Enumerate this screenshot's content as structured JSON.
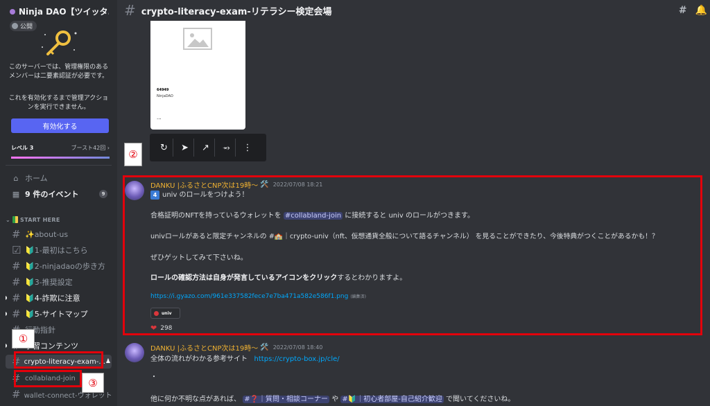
{
  "server": {
    "name": "Ninja DAO【ツイッタ...",
    "public_label": "公開"
  },
  "auth": {
    "text1": "このサーバーでは、管理権限のあるメンバーは二要素認証が必要です。",
    "text2": "これを有効化するまで管理アクションを実行できません。",
    "enable_label": "有効化する"
  },
  "level": {
    "label": "レベル 3",
    "boost": "ブースト42回 ›"
  },
  "nav": {
    "home": "ホーム",
    "events": "9 件のイベント",
    "events_count": "9"
  },
  "category": "START HERE",
  "channels": [
    {
      "label": "✨about-us"
    },
    {
      "label": "🔰1-最初はこちら"
    },
    {
      "label": "🔰2-ninjadaoの歩き方"
    },
    {
      "label": "🔰3-推奨設定"
    },
    {
      "label": "🔰4-詐欺に注意"
    },
    {
      "label": "🔰5-サイトマップ"
    },
    {
      "label": "行動指針"
    },
    {
      "label": "学習コンテンツ"
    },
    {
      "label": "crypto-literacy-exam-..."
    },
    {
      "label": "collabland-join"
    },
    {
      "label": "wallet-connect-ウォレット..."
    }
  ],
  "annotations": {
    "n1": "①",
    "n2": "②",
    "n3": "③"
  },
  "header": {
    "channel": "crypto-literacy-exam-リテラシー検定会場"
  },
  "card": {
    "line1": "64949",
    "line2": "NinjaDAO",
    "line3": "..."
  },
  "message1": {
    "user": "DANKU |ふるさとCNP次は19時〜",
    "tool": "🛠️",
    "time": "2022/07/08 18:21",
    "num": "4",
    "line1": "univ のロールをつけよう！",
    "line2a": "合格証明のNFTを持っているウォレットを ",
    "line2m": "#collabland-join",
    "line2b": " に接続すると univ のロールがつきます。",
    "line3": "univロールがあると限定チャンネルの #🏫｜crypto-univ（nft、仮想通貨全般について語るチャンネル） を見ることができたり、今後特典がつくことがあるかも！？",
    "line4": "ぜひゲットしてみて下さいね。",
    "line5a": "ロールの確認方法は自身が発言しているアイコンをクリック",
    "line5b": "するとわかりますよ。",
    "link": "https://i.gyazo.com/961e337582fece7e7ba471a582e586f1.png",
    "edited": "(編集済)",
    "role": "univ",
    "reaction_count": "298"
  },
  "message2": {
    "user": "DANKU |ふるさとCNP次は19時〜",
    "tool": "🛠️",
    "time": "2022/07/08 18:40",
    "line1": "全体の流れがわかる参考サイト",
    "link": "https://crypto-box.jp/cle/",
    "dot": "・",
    "line3a": "他に何か不明な点があれば、 ",
    "m1": "#❓｜質問・相談コーナー",
    "mid": " や ",
    "m2": "#🔰｜初心者部屋-自己紹介歓迎",
    "line3b": " で聞いてくださいね。"
  },
  "colors": {
    "annotation_red": "#e3000b",
    "blurple": "#5865f2",
    "username": "#f0b232",
    "link": "#00a8fc"
  }
}
